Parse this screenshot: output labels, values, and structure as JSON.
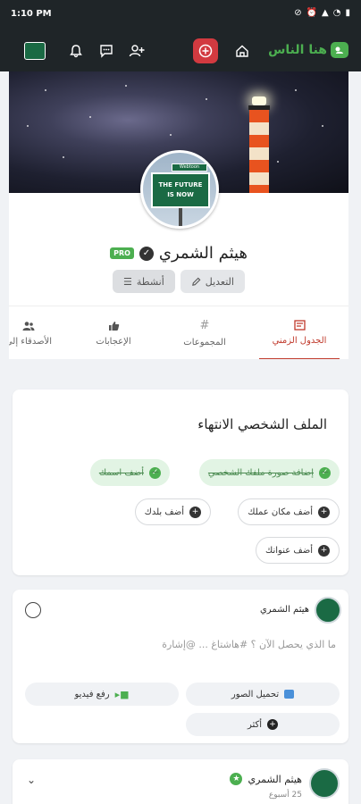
{
  "status_bar": {
    "time": "1:10 PM"
  },
  "header": {
    "brand": "هنا الناس",
    "icons": [
      "bell-icon",
      "chat-icon",
      "add-friend-icon",
      "add-icon",
      "home-icon"
    ]
  },
  "profile": {
    "name": "هيثم الشمري",
    "badge": "PRO",
    "avatar_sign_top": "Webtoon",
    "avatar_sign_line1": "THE FUTURE",
    "avatar_sign_line2": "IS NOW",
    "edit_label": "التعديل",
    "activities_label": "أنشطة"
  },
  "tabs": [
    {
      "label": "الجدول الزمني",
      "icon": "timeline-icon"
    },
    {
      "label": "المجموعات",
      "icon": "hashtag-icon"
    },
    {
      "label": "الإعجابات",
      "icon": "thumbs-up-icon"
    },
    {
      "label": "الأصدقاء إلى",
      "icon": "friends-icon"
    }
  ],
  "completion": {
    "title": "الملف الشخصي الانتهاء",
    "done": [
      "إضافة صورة ملفك الشخصي",
      "أضف اسمك"
    ],
    "todo": [
      "أضف مكان عملك",
      "أضف بلدك",
      "أضف عنوانك"
    ]
  },
  "composer": {
    "name": "هيثم الشمري",
    "placeholder": "ما الذي يحصل الآن ؟ #هاشتاغ ... @إشارة",
    "upload_photos": "تحميل الصور",
    "upload_video": "رفع فيديو",
    "more": "أكثر"
  },
  "post": {
    "name": "هيثم الشمري",
    "time": "25 أسبوع"
  },
  "colors": {
    "accent": "#c0392b",
    "brand": "#4caf50",
    "nav_bg": "#1f2528"
  }
}
